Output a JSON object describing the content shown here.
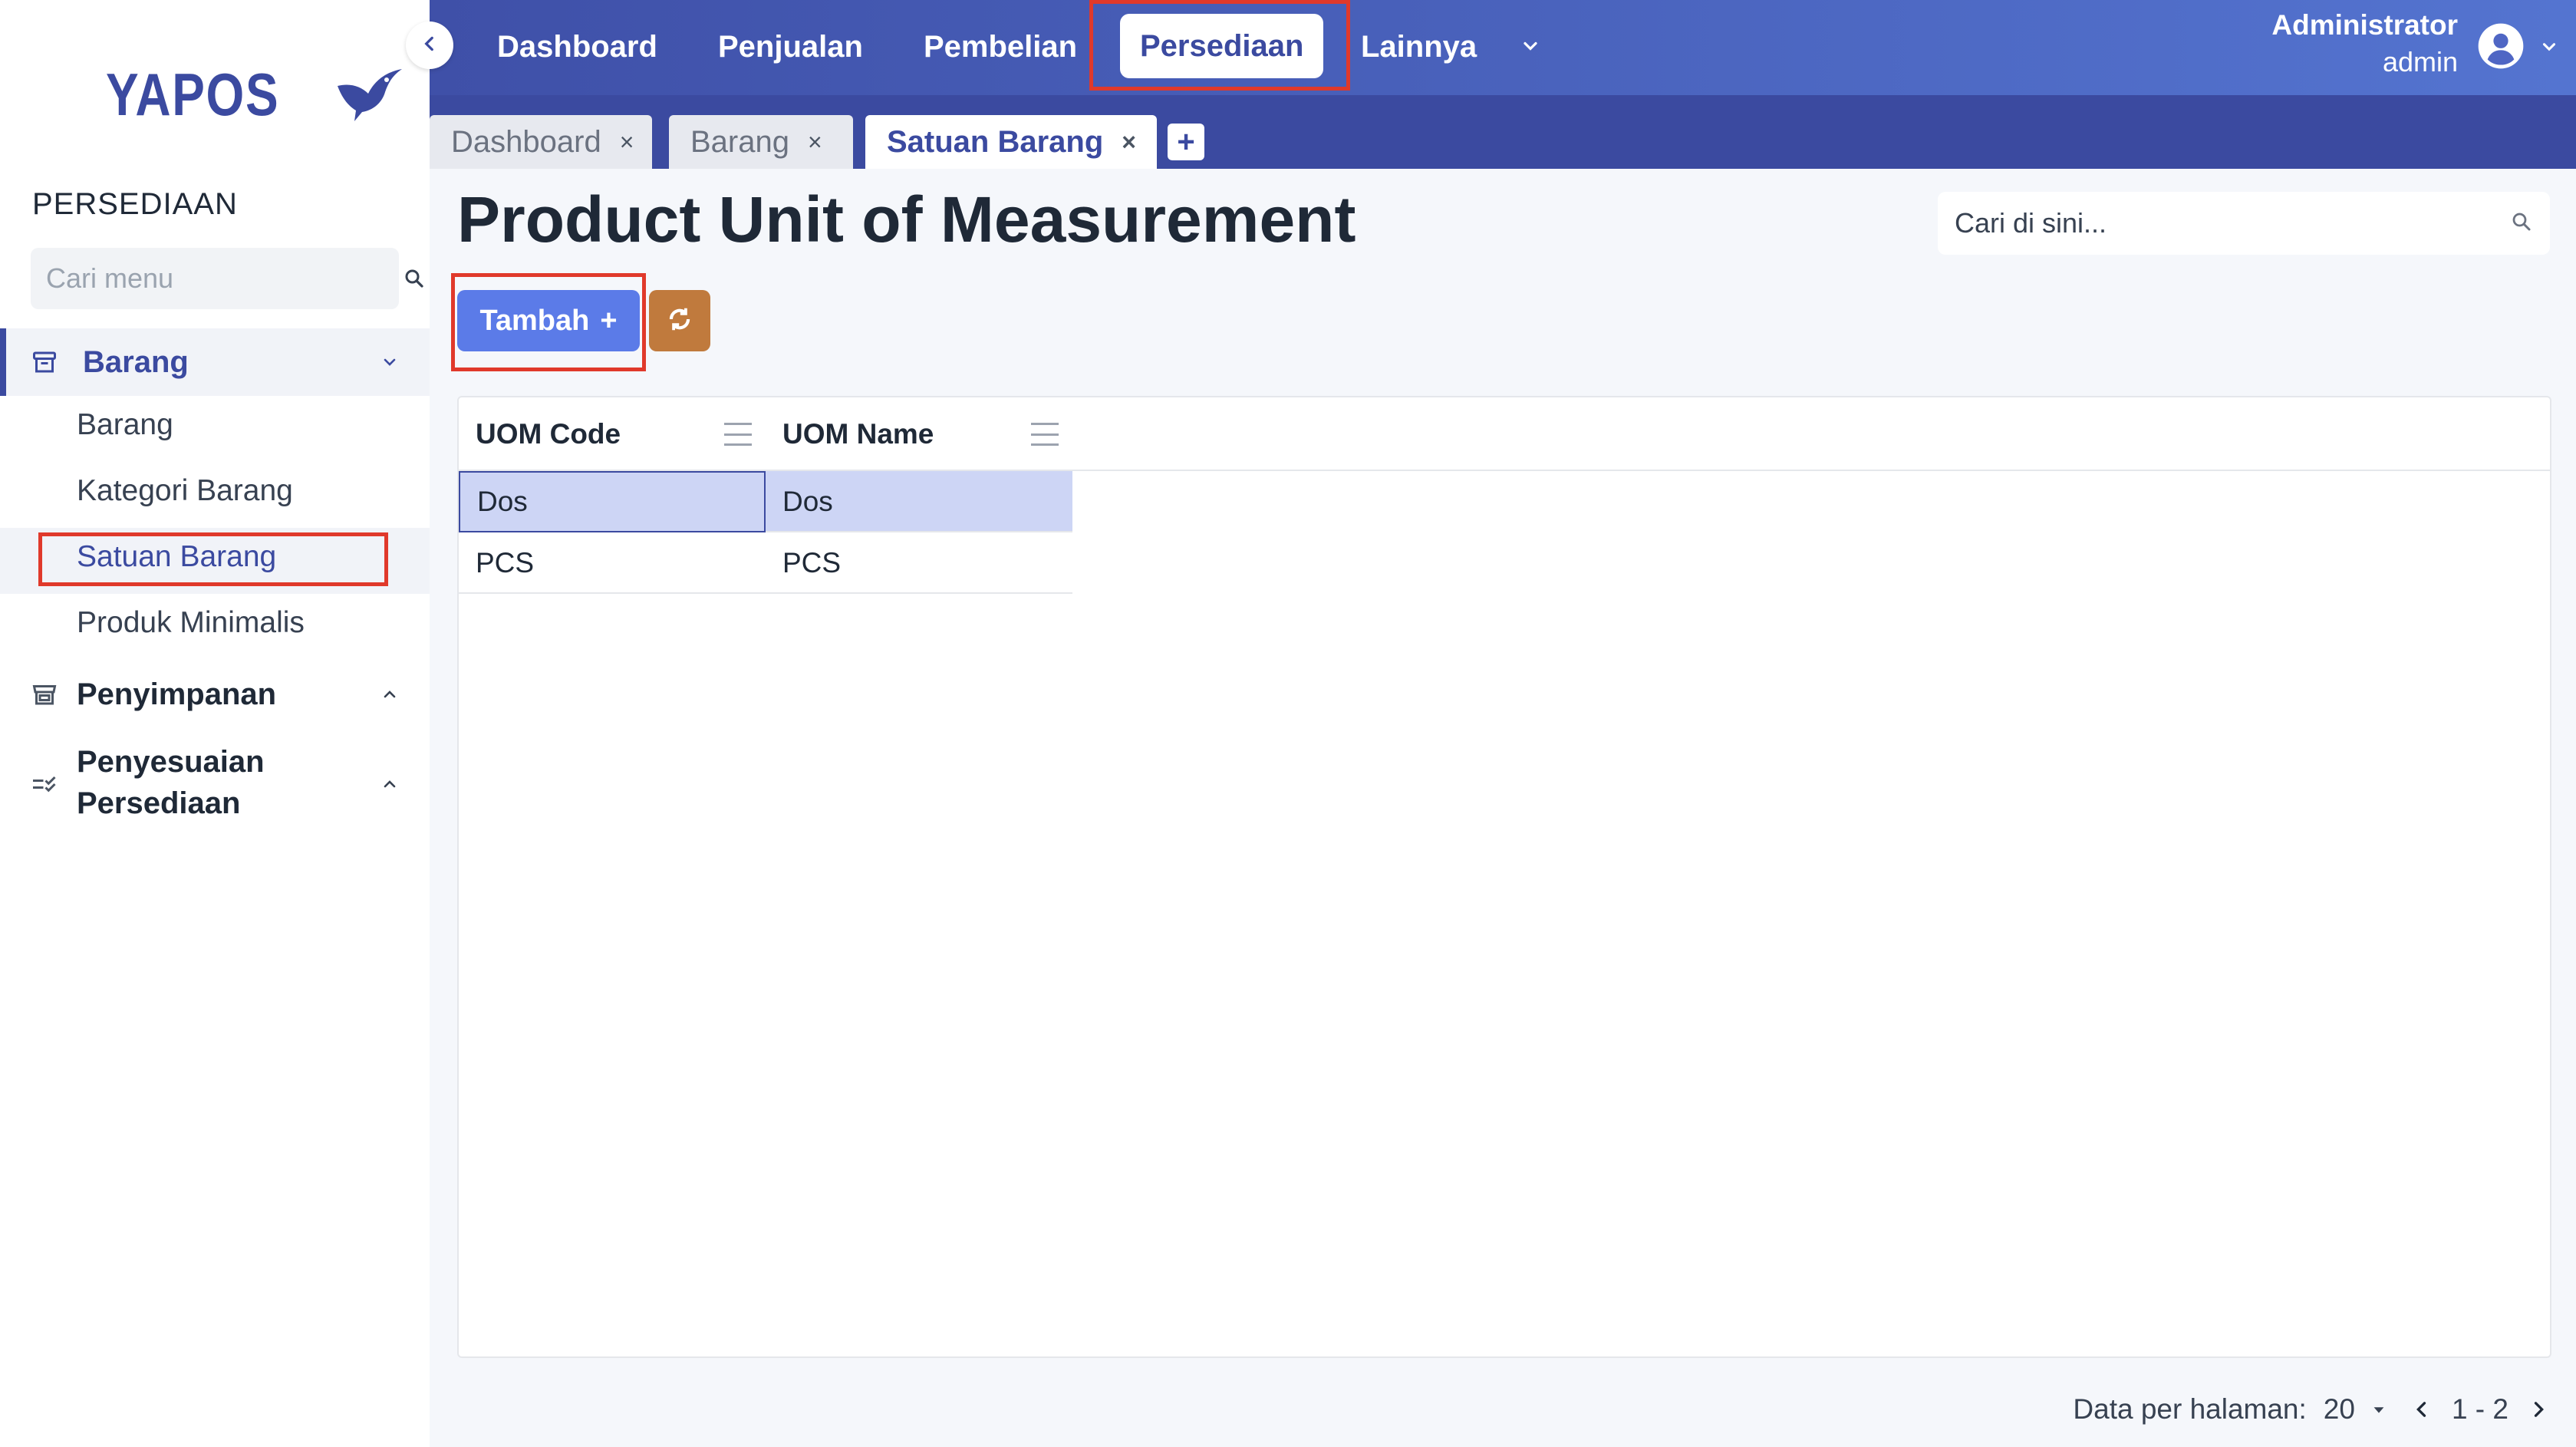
{
  "app": {
    "logo_text": "YAPOS",
    "brand_color": "#3b4aa0",
    "accent_color": "#5b7be8"
  },
  "sidebar": {
    "section_title": "PERSEDIAAN",
    "search_placeholder": "Cari menu",
    "groups": [
      {
        "label": "Barang",
        "icon": "archive-box-icon",
        "expanded": true,
        "items": [
          {
            "label": "Barang"
          },
          {
            "label": "Kategori Barang"
          },
          {
            "label": "Satuan Barang",
            "active": true
          },
          {
            "label": "Produk Minimalis"
          }
        ]
      },
      {
        "label": "Penyimpanan",
        "icon": "storefront-icon",
        "expanded": false
      },
      {
        "label_line1": "Penyesuaian",
        "label_line2": "Persediaan",
        "icon": "checklist-icon",
        "expanded": false
      }
    ]
  },
  "topnav": {
    "items": [
      {
        "label": "Dashboard"
      },
      {
        "label": "Penjualan"
      },
      {
        "label": "Pembelian"
      },
      {
        "label": "Persediaan",
        "active": true
      },
      {
        "label": "Lainnya"
      }
    ],
    "user": {
      "name": "Administrator",
      "role": "admin"
    }
  },
  "tabs": [
    {
      "label": "Dashboard",
      "close": "×"
    },
    {
      "label": "Barang",
      "close": "×"
    },
    {
      "label": "Satuan Barang",
      "close": "×",
      "active": true
    }
  ],
  "tab_add_label": "+",
  "main": {
    "title": "Product Unit of Measurement",
    "search_placeholder": "Cari di sini...",
    "add_button_label": "Tambah",
    "add_button_icon": "+",
    "refresh_icon": "refresh-icon",
    "refresh_color": "#c07a3d"
  },
  "table": {
    "columns": [
      "UOM Code",
      "UOM Name"
    ],
    "rows": [
      {
        "code": "Dos",
        "name": "Dos",
        "selected": true
      },
      {
        "code": "PCS",
        "name": "PCS"
      }
    ]
  },
  "footer": {
    "per_page_label": "Data per halaman:",
    "per_page_value": "20",
    "range": "1 - 2"
  }
}
